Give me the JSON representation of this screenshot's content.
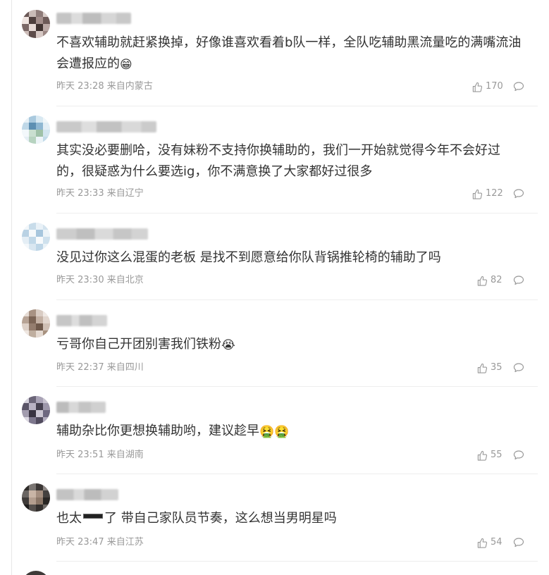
{
  "comments": [
    {
      "text": "不喜欢辅助就赶紧换掉，好像谁喜欢看着b队一样，全队吃辅助黑流量吃的满嘴流油会遭报应的",
      "emoji": "😁",
      "time": "昨天 23:28",
      "location": "来自内蒙古",
      "likes": "170"
    },
    {
      "text": "其实没必要删哈，没有妹粉不支持你换辅助的，我们一开始就觉得今年不会好过的，很疑惑为什么要选ig，你不满意换了大家都好过很多",
      "emoji": "",
      "time": "昨天 23:33",
      "location": "来自辽宁",
      "likes": "122"
    },
    {
      "text": "没见过你这么混蛋的老板 是找不到愿意给你队背锅推轮椅的辅助了吗",
      "emoji": "",
      "time": "昨天 23:30",
      "location": "来自北京",
      "likes": "82"
    },
    {
      "text": "亏哥你自己开团别害我们铁粉",
      "emoji": "😭",
      "time": "昨天 22:37",
      "location": "来自四川",
      "likes": "35"
    },
    {
      "text": "辅助杂比你更想换辅助哟，建议趁早",
      "emoji": "🤮🤮",
      "time": "昨天 23:51",
      "location": "来自湖南",
      "likes": "55"
    },
    {
      "text_before": "也太",
      "text_after": "了 带自己家队员节奏，这么想当男明星吗",
      "time": "昨天 23:47",
      "location": "来自江苏",
      "likes": "54"
    }
  ],
  "icons": {
    "like": "thumbs-up-icon",
    "reply": "comment-bubble-icon"
  },
  "colors": {
    "text": "#333333",
    "meta": "#999999",
    "divider": "#eeeeee"
  }
}
